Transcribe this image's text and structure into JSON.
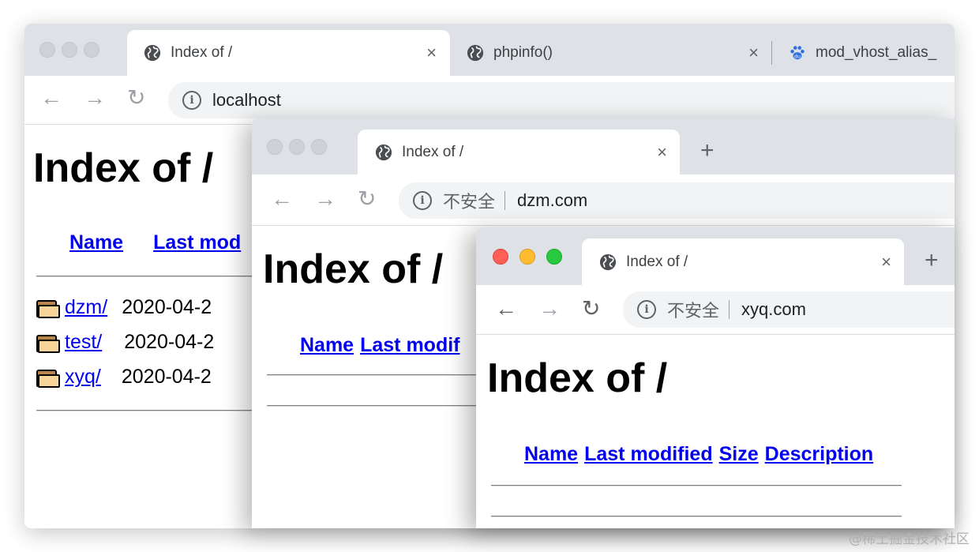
{
  "window_back": {
    "tabs": [
      {
        "title": "Index of /",
        "icon": "globe-icon",
        "active": true
      },
      {
        "title": "phpinfo()",
        "icon": "globe-icon",
        "active": false
      },
      {
        "title": "mod_vhost_alias_",
        "icon": "baidu-paw-icon",
        "active": false
      }
    ],
    "url": "localhost",
    "heading": "Index of /",
    "columns": [
      "Name",
      "Last mod"
    ],
    "rows": [
      {
        "name": "dzm/",
        "modified": "2020-04-2"
      },
      {
        "name": "test/",
        "modified": "2020-04-2"
      },
      {
        "name": "xyq/",
        "modified": "2020-04-2"
      }
    ]
  },
  "window_middle": {
    "tab_title": "Index of /",
    "security_label": "不安全",
    "url": "dzm.com",
    "heading": "Index of /",
    "columns": [
      "Name",
      "Last modif"
    ]
  },
  "window_front": {
    "tab_title": "Index of /",
    "security_label": "不安全",
    "url": "xyq.com",
    "heading": "Index of /",
    "columns": [
      "Name",
      "Last modified",
      "Size",
      "Description"
    ]
  },
  "glyphs": {
    "close": "×",
    "new_tab": "+",
    "back": "←",
    "forward": "→",
    "reload": "↻",
    "info": "i"
  },
  "watermark": "@稀土掘金技术社区"
}
